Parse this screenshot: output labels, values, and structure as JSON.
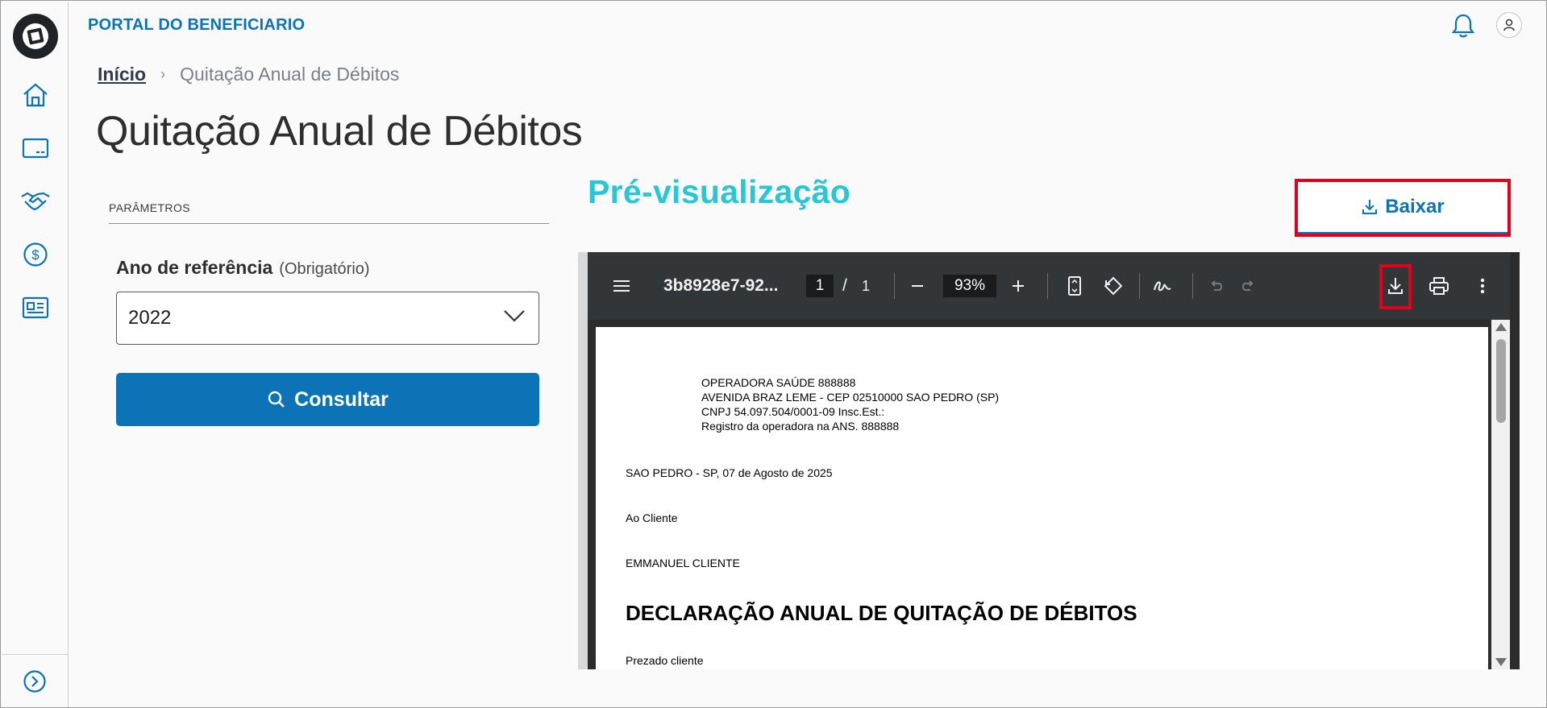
{
  "app": {
    "title": "PORTAL DO BENEFICIARIO"
  },
  "sidebar": {
    "items": [
      {
        "icon": "home-icon"
      },
      {
        "icon": "card-icon"
      },
      {
        "icon": "handshake-icon"
      },
      {
        "icon": "dollar-icon"
      },
      {
        "icon": "document-list-icon"
      }
    ],
    "expand_icon": "chevron-right-circle-icon"
  },
  "header": {
    "notifications_icon": "bell-icon",
    "user_icon": "user-icon"
  },
  "breadcrumb": {
    "home": "Início",
    "current": "Quitação Anual de Débitos"
  },
  "page": {
    "title": "Quitação Anual de Débitos"
  },
  "params": {
    "section_label": "PARÂMETROS",
    "year_label": "Ano de referência",
    "year_required": "(Obrigatório)",
    "year_value": "2022",
    "search_button": "Consultar"
  },
  "preview": {
    "title": "Pré-visualização",
    "download_button": "Baixar"
  },
  "viewer": {
    "filename": "3b8928e7-92...",
    "page_current": "1",
    "page_sep": "/",
    "page_total": "1",
    "zoom": "93%",
    "document": {
      "header_lines": [
        "OPERADORA SAÚDE 888888",
        "AVENIDA BRAZ LEME - CEP 02510000 SAO PEDRO (SP)",
        "CNPJ 54.097.504/0001-09  Insc.Est.:",
        "Registro da operadora na ANS. 888888"
      ],
      "date_line": "SAO PEDRO - SP, 07 de Agosto de 2025",
      "to_line": "Ao Cliente",
      "client_name": "EMMANUEL CLIENTE",
      "heading": "DECLARAÇÃO ANUAL DE QUITAÇÃO DE DÉBITOS",
      "greeting": "Prezado cliente"
    }
  },
  "colors": {
    "brand": "#0c73b7",
    "preview_title": "#27c7d6",
    "highlight": "#e3001b"
  }
}
